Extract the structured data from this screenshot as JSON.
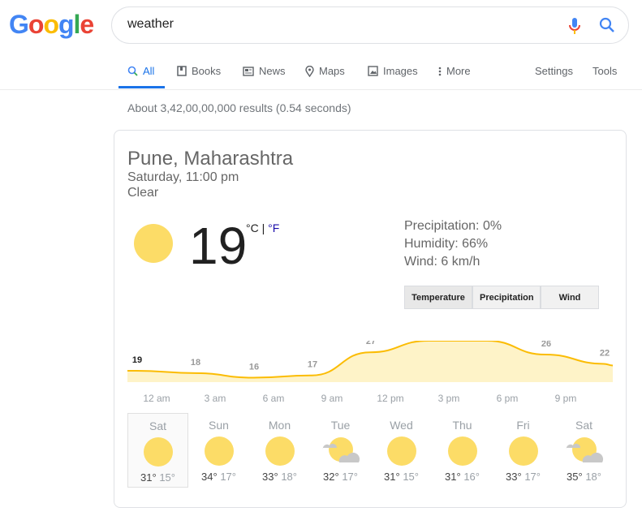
{
  "header": {
    "logo": "Google",
    "query": "weather"
  },
  "tabs": [
    {
      "label": "All",
      "icon": "search-icon",
      "active": true
    },
    {
      "label": "Books",
      "icon": "book-icon"
    },
    {
      "label": "News",
      "icon": "news-icon"
    },
    {
      "label": "Maps",
      "icon": "map-pin-icon"
    },
    {
      "label": "Images",
      "icon": "image-icon"
    },
    {
      "label": "More",
      "icon": "more-vert-icon"
    }
  ],
  "tools": {
    "settings": "Settings",
    "tools": "Tools"
  },
  "stats": "About 3,42,00,00,000 results (0.54 seconds)",
  "weather": {
    "location": "Pune, Maharashtra",
    "time": "Saturday, 11:00 pm",
    "condition": "Clear",
    "temp": "19",
    "unit_c": "°C",
    "sep": " | ",
    "unit_f": "°F",
    "precipitation": "Precipitation: 0%",
    "humidity": "Humidity: 66%",
    "wind": "Wind: 6 km/h",
    "buttons": [
      "Temperature",
      "Precipitation",
      "Wind"
    ]
  },
  "chart_data": {
    "type": "area",
    "x": [
      "12 am",
      "3 am",
      "6 am",
      "9 am",
      "12 pm",
      "3 pm",
      "6 pm",
      "9 pm",
      ""
    ],
    "values": [
      19,
      18,
      16,
      17,
      27,
      32,
      32,
      26,
      22
    ],
    "color": "#fbbc04",
    "fill": "#fef3c8"
  },
  "days": [
    {
      "name": "Sat",
      "hi": "31°",
      "lo": "15°",
      "icon": "sun"
    },
    {
      "name": "Sun",
      "hi": "34°",
      "lo": "17°",
      "icon": "sun"
    },
    {
      "name": "Mon",
      "hi": "33°",
      "lo": "18°",
      "icon": "sun"
    },
    {
      "name": "Tue",
      "hi": "32°",
      "lo": "17°",
      "icon": "partly-cloudy"
    },
    {
      "name": "Wed",
      "hi": "31°",
      "lo": "15°",
      "icon": "sun"
    },
    {
      "name": "Thu",
      "hi": "31°",
      "lo": "16°",
      "icon": "sun"
    },
    {
      "name": "Fri",
      "hi": "33°",
      "lo": "17°",
      "icon": "sun"
    },
    {
      "name": "Sat",
      "hi": "35°",
      "lo": "18°",
      "icon": "partly-cloudy"
    }
  ]
}
